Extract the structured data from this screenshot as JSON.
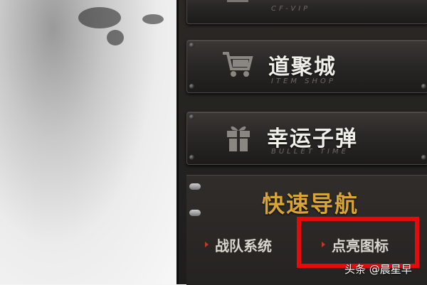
{
  "menu": {
    "vip": {
      "title": "",
      "subtitle": "CF-VIP"
    },
    "item_shop": {
      "title": "道聚城",
      "subtitle": "ITEM SHOP",
      "icon": "cart-icon"
    },
    "bullet_time": {
      "title": "幸运子弹",
      "subtitle": "BULLET TIME",
      "icon": "gift-icon"
    }
  },
  "quick_nav": {
    "title": "快速导航",
    "links": [
      {
        "label": "战队系统"
      },
      {
        "label": "点亮图标"
      }
    ]
  },
  "watermark": "头条 @晨星早",
  "colors": {
    "nav_title": "#d9a436",
    "highlight": "#e50b0b",
    "bullet": "#c0392b"
  }
}
